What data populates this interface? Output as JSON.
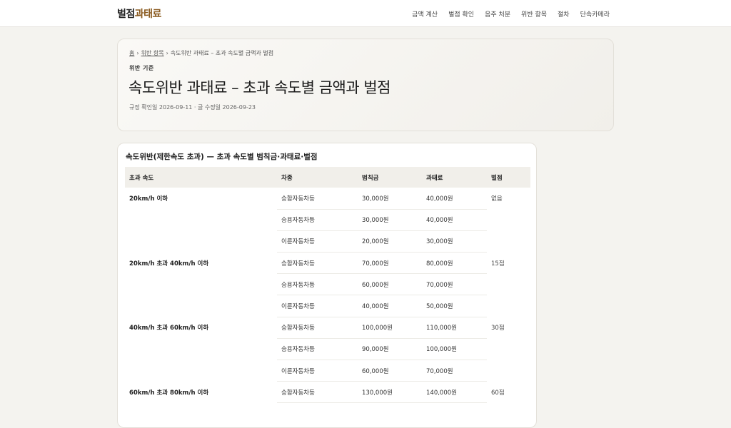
{
  "header": {
    "logo_main": "벌점",
    "logo_accent": "과태료",
    "nav": [
      "금액 계산",
      "벌점 확인",
      "음주 처분",
      "위반 항목",
      "절차",
      "단속카메라"
    ]
  },
  "hero": {
    "breadcrumb": [
      "홈",
      "위반 항목",
      "속도위반 과태료 – 초과 속도별 금액과 벌점"
    ],
    "eyebrow": "위반 기준",
    "title": "속도위반 과태료 – 초과 속도별 금액과 벌점",
    "meta": "규정 확인일 2026-09-11 · 글 수정일 2026-09-23"
  },
  "table": {
    "caption": "속도위반(제한속도 초과) — 초과 속도별 범칙금·과태료·벌점",
    "headers": [
      "초과 속도",
      "차종",
      "범칙금",
      "과태료",
      "벌점"
    ],
    "groups": [
      {
        "speed": "20km/h 이하",
        "points": "없음",
        "rows": [
          {
            "vehicle": "승합자동차등",
            "fine": "30,000원",
            "penalty": "40,000원"
          },
          {
            "vehicle": "승용자동차등",
            "fine": "30,000원",
            "penalty": "40,000원"
          },
          {
            "vehicle": "이륜자동차등",
            "fine": "20,000원",
            "penalty": "30,000원"
          }
        ]
      },
      {
        "speed": "20km/h 초과 40km/h 이하",
        "points": "15점",
        "rows": [
          {
            "vehicle": "승합자동차등",
            "fine": "70,000원",
            "penalty": "80,000원"
          },
          {
            "vehicle": "승용자동차등",
            "fine": "60,000원",
            "penalty": "70,000원"
          },
          {
            "vehicle": "이륜자동차등",
            "fine": "40,000원",
            "penalty": "50,000원"
          }
        ]
      },
      {
        "speed": "40km/h 초과 60km/h 이하",
        "points": "30점",
        "rows": [
          {
            "vehicle": "승합자동차등",
            "fine": "100,000원",
            "penalty": "110,000원"
          },
          {
            "vehicle": "승용자동차등",
            "fine": "90,000원",
            "penalty": "100,000원"
          },
          {
            "vehicle": "이륜자동차등",
            "fine": "60,000원",
            "penalty": "70,000원"
          }
        ]
      },
      {
        "speed": "60km/h 초과 80km/h 이하",
        "points": "60점",
        "rows": [
          {
            "vehicle": "승합자동차등",
            "fine": "130,000원",
            "penalty": "140,000원"
          }
        ]
      }
    ]
  }
}
